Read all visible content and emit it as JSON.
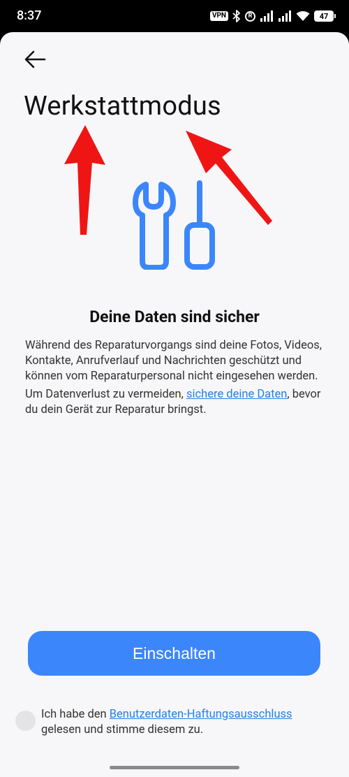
{
  "status_bar": {
    "time": "8:37",
    "vpn_label": "VPN",
    "r_label": "R",
    "battery_level": "47",
    "icons": [
      "vpn-icon",
      "bluetooth-icon",
      "registered-icon",
      "signal-icon",
      "signal-icon",
      "wifi-icon",
      "battery-icon"
    ]
  },
  "header": {
    "back_icon": "back-arrow-icon",
    "title": "Werkstattmodus"
  },
  "hero": {
    "icon": "tools-icon",
    "icon_color": "#3c86fb",
    "annotation_color": "#f01515"
  },
  "content": {
    "headline": "Deine Daten sind sicher",
    "paragraph_1": "Während des Reparaturvorgangs sind deine Fotos, Videos, Kontakte, Anrufverlauf und Nachrichten geschützt und können vom Reparaturpersonal nicht eingesehen werden.",
    "paragraph_2_before": "Um Datenverlust zu vermeiden, ",
    "paragraph_2_link": "sichere deine Daten",
    "paragraph_2_after": ", bevor du dein Gerät zur Reparatur bringst."
  },
  "actions": {
    "primary_label": "Einschalten",
    "primary_color": "#3c86fb"
  },
  "consent": {
    "checked": false,
    "text_before": "Ich habe den ",
    "link_text": "Benutzerdaten-Haftungsausschluss",
    "text_after": " gelesen und stimme diesem zu."
  }
}
